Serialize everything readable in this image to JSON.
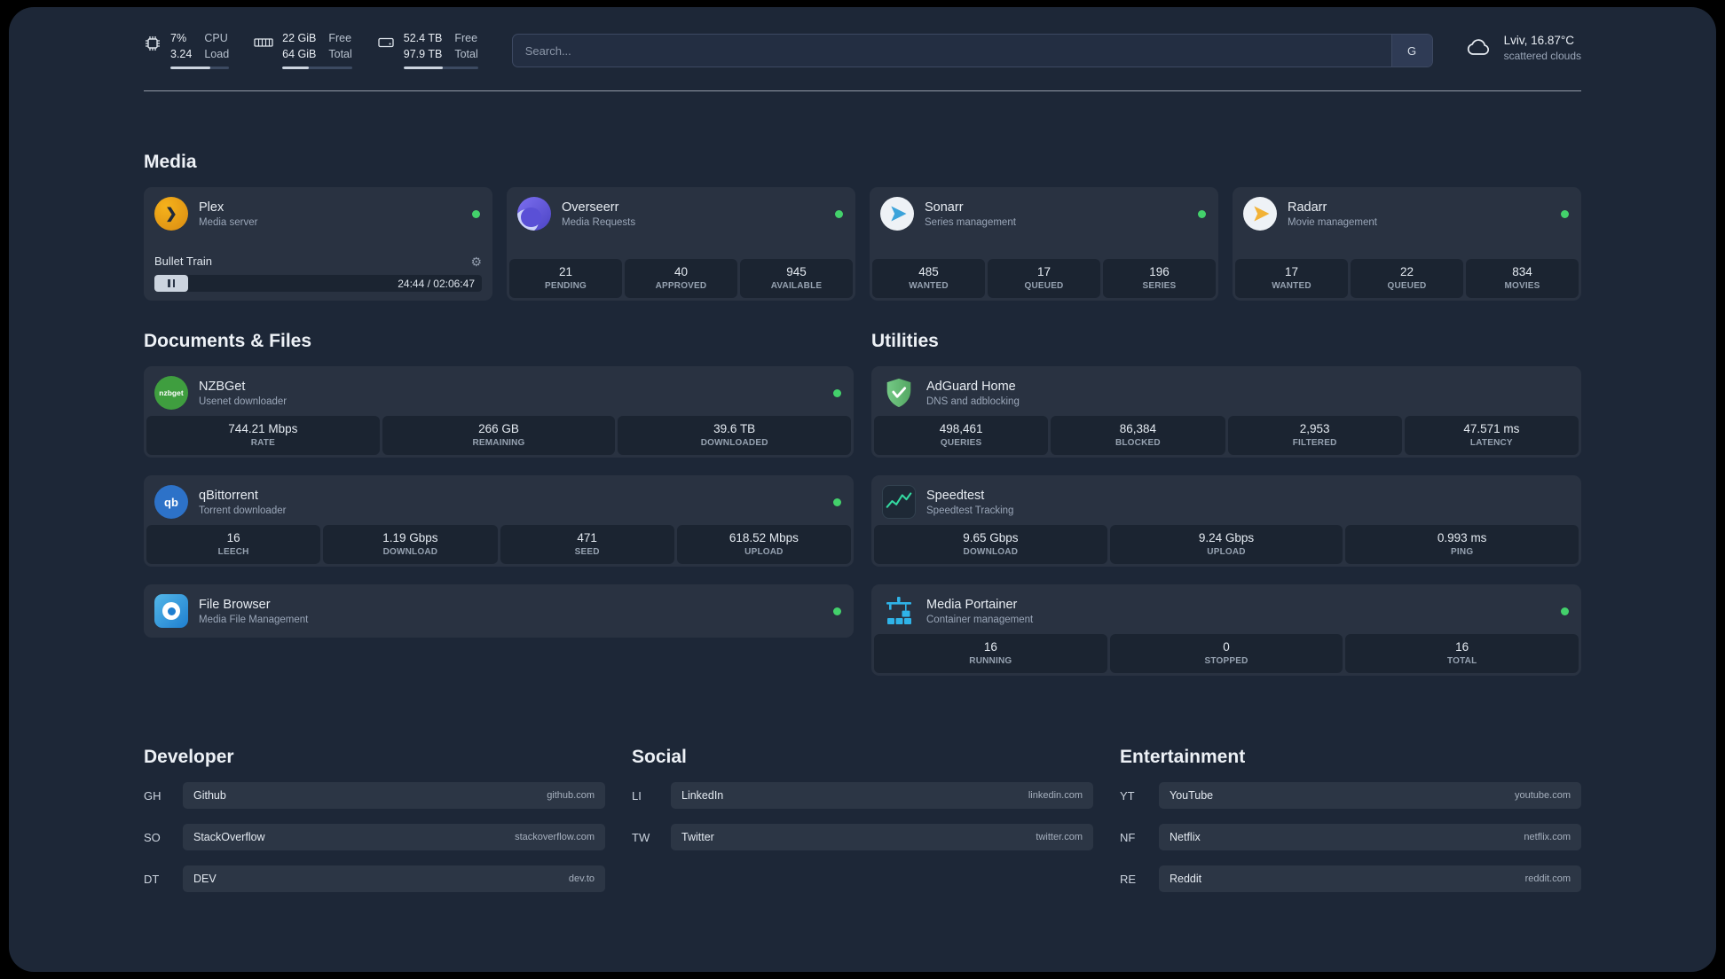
{
  "topbar": {
    "cpu": {
      "v1": "7%",
      "v2": "3.24",
      "l1": "CPU",
      "l2": "Load",
      "bar": "68%"
    },
    "mem": {
      "v1": "22 GiB",
      "v2": "64 GiB",
      "l1": "Free",
      "l2": "Total",
      "bar": "38%"
    },
    "disk": {
      "v1": "52.4 TB",
      "v2": "97.9 TB",
      "l1": "Free",
      "l2": "Total",
      "bar": "53%"
    },
    "search": {
      "placeholder": "Search...",
      "button_label": "G"
    },
    "weather": {
      "location": "Lviv, 16.87°C",
      "condition": "scattered clouds"
    }
  },
  "sections": {
    "media": {
      "title": "Media",
      "plex": {
        "name": "Plex",
        "subtitle": "Media server",
        "player_title": "Bullet Train",
        "player_time": "24:44 / 02:06:47"
      },
      "overseerr": {
        "name": "Overseerr",
        "subtitle": "Media Requests",
        "stats": [
          {
            "value": "21",
            "label": "PENDING"
          },
          {
            "value": "40",
            "label": "APPROVED"
          },
          {
            "value": "945",
            "label": "AVAILABLE"
          }
        ]
      },
      "sonarr": {
        "name": "Sonarr",
        "subtitle": "Series management",
        "stats": [
          {
            "value": "485",
            "label": "WANTED"
          },
          {
            "value": "17",
            "label": "QUEUED"
          },
          {
            "value": "196",
            "label": "SERIES"
          }
        ]
      },
      "radarr": {
        "name": "Radarr",
        "subtitle": "Movie management",
        "stats": [
          {
            "value": "17",
            "label": "WANTED"
          },
          {
            "value": "22",
            "label": "QUEUED"
          },
          {
            "value": "834",
            "label": "MOVIES"
          }
        ]
      }
    },
    "documents": {
      "title": "Documents & Files",
      "nzbget": {
        "name": "NZBGet",
        "subtitle": "Usenet downloader",
        "icon_label": "nzbget",
        "stats": [
          {
            "value": "744.21 Mbps",
            "label": "RATE"
          },
          {
            "value": "266 GB",
            "label": "REMAINING"
          },
          {
            "value": "39.6 TB",
            "label": "DOWNLOADED"
          }
        ]
      },
      "qbittorrent": {
        "name": "qBittorrent",
        "subtitle": "Torrent downloader",
        "icon_label": "qb",
        "stats": [
          {
            "value": "16",
            "label": "LEECH"
          },
          {
            "value": "1.19 Gbps",
            "label": "DOWNLOAD"
          },
          {
            "value": "471",
            "label": "SEED"
          },
          {
            "value": "618.52 Mbps",
            "label": "UPLOAD"
          }
        ]
      },
      "filebrowser": {
        "name": "File Browser",
        "subtitle": "Media File Management"
      }
    },
    "utilities": {
      "title": "Utilities",
      "adguard": {
        "name": "AdGuard Home",
        "subtitle": "DNS and adblocking",
        "stats": [
          {
            "value": "498,461",
            "label": "QUERIES"
          },
          {
            "value": "86,384",
            "label": "BLOCKED"
          },
          {
            "value": "2,953",
            "label": "FILTERED"
          },
          {
            "value": "47.571 ms",
            "label": "LATENCY"
          }
        ]
      },
      "speedtest": {
        "name": "Speedtest",
        "subtitle": "Speedtest Tracking",
        "stats": [
          {
            "value": "9.65 Gbps",
            "label": "DOWNLOAD"
          },
          {
            "value": "9.24 Gbps",
            "label": "UPLOAD"
          },
          {
            "value": "0.993 ms",
            "label": "PING"
          }
        ]
      },
      "portainer": {
        "name": "Media Portainer",
        "subtitle": "Container management",
        "stats": [
          {
            "value": "16",
            "label": "RUNNING"
          },
          {
            "value": "0",
            "label": "STOPPED"
          },
          {
            "value": "16",
            "label": "TOTAL"
          }
        ]
      }
    },
    "bookmarks": {
      "developer": {
        "title": "Developer",
        "links": [
          {
            "abbr": "GH",
            "name": "Github",
            "domain": "github.com"
          },
          {
            "abbr": "SO",
            "name": "StackOverflow",
            "domain": "stackoverflow.com"
          },
          {
            "abbr": "DT",
            "name": "DEV",
            "domain": "dev.to"
          }
        ]
      },
      "social": {
        "title": "Social",
        "links": [
          {
            "abbr": "LI",
            "name": "LinkedIn",
            "domain": "linkedin.com"
          },
          {
            "abbr": "TW",
            "name": "Twitter",
            "domain": "twitter.com"
          }
        ]
      },
      "entertainment": {
        "title": "Entertainment",
        "links": [
          {
            "abbr": "YT",
            "name": "YouTube",
            "domain": "youtube.com"
          },
          {
            "abbr": "NF",
            "name": "Netflix",
            "domain": "netflix.com"
          },
          {
            "abbr": "RE",
            "name": "Reddit",
            "domain": "reddit.com"
          }
        ]
      }
    }
  }
}
